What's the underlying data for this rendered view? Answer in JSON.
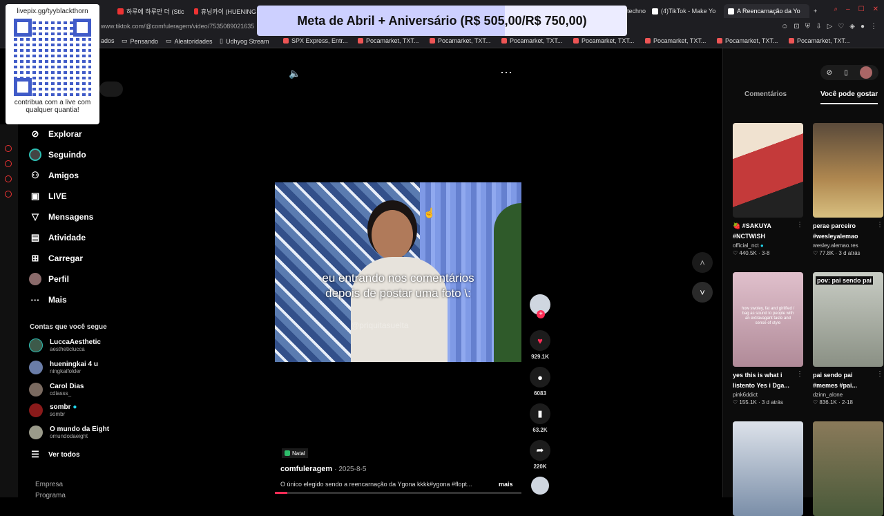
{
  "tabs": [
    {
      "label": "하루에 하루만 더 (Stic",
      "active": false
    },
    {
      "label": "휴닝카이 (HUENING",
      "active": false
    },
    {
      "label": "techno",
      "active": false
    },
    {
      "label": "(4)TikTok - Make Yo",
      "active": false
    },
    {
      "label": "A Reencarnação da Yo",
      "active": true
    }
  ],
  "url": "www.tiktok.com/@comfuleragem/video/7535089021635",
  "bookmarks": [
    "ados",
    "Pensando",
    "Aleatoridades",
    "Udhyog Stream",
    "SPX Express, Entr...",
    "Pocamarket, TXT...",
    "Pocamarket, TXT...",
    "Pocamarket, TXT...",
    "Pocamarket, TXT...",
    "Pocamarket, TXT...",
    "Pocamarket, TXT...",
    "Pocamarket, TXT..."
  ],
  "overlay": {
    "qr_title": "livepix.gg/tyyblackthorn",
    "qr_caption": "contribua com a live com qualquer quantia!",
    "goal": "Meta de Abril + Aniversário (R$ 505,00/R$ 750,00)",
    "goal_progress": 0.673
  },
  "nav": [
    {
      "label": "Explorar",
      "icon": "compass-icon"
    },
    {
      "label": "Seguindo",
      "icon": "following-icon"
    },
    {
      "label": "Amigos",
      "icon": "friends-icon"
    },
    {
      "label": "LIVE",
      "icon": "live-icon"
    },
    {
      "label": "Mensagens",
      "icon": "messages-icon"
    },
    {
      "label": "Atividade",
      "icon": "activity-icon"
    },
    {
      "label": "Carregar",
      "icon": "upload-icon"
    },
    {
      "label": "Perfil",
      "icon": "profile-icon"
    },
    {
      "label": "Mais",
      "icon": "more-icon"
    }
  ],
  "following_title": "Contas que você segue",
  "following": [
    {
      "name": "LuccaAesthetic",
      "handle": "aestheticlucca",
      "color": "#3d5a4a"
    },
    {
      "name": "hueningkai 4 u",
      "handle": "ningkaifolder",
      "color": "#6a7da8"
    },
    {
      "name": "Carol Dias",
      "handle": "cdiasss_",
      "color": "#7a6a60"
    },
    {
      "name": "sombr",
      "handle": "sombr",
      "color": "#8a1a1a",
      "verified": true
    },
    {
      "name": "O mundo da Eight",
      "handle": "omundodaeight",
      "color": "#9a9a8a"
    }
  ],
  "see_all": "Ver todos",
  "footer": [
    "Empresa",
    "Programa"
  ],
  "video": {
    "caption_line1": "eu entrando nos comentários",
    "caption_line2": "depois de postar uma foto \\:",
    "watermark": "@priquitasuelta",
    "tag": "Natal",
    "author": "comfuleragem",
    "date": "· 2025-8-5",
    "description": "O único elegido sendo a reencarnação da Ygona kkkk#ygona #flopt...",
    "more": "mais",
    "progress": 0.05
  },
  "actions": {
    "likes": "929.1K",
    "comments": "6083",
    "saves": "63.2K",
    "shares": "220K"
  },
  "right_tabs": [
    "Comentários",
    "Você pode gostar"
  ],
  "cards": [
    {
      "title": "🍓 #SAKUYA #NCTWISH",
      "author": "official_nct",
      "verified": true,
      "likes": "440.5K",
      "date": "3-8",
      "bg": "#c43a3a"
    },
    {
      "title": "perae parceiro #wesleyalemao",
      "author": "wesley.alemao.res",
      "likes": "77.8K",
      "date": "3 d atrás",
      "bg": "#7a5a3a"
    },
    {
      "title": "yes this is what i listento Yes i Dga...",
      "author": "pink6ddict",
      "likes": "155.1K",
      "date": "3 d atrás",
      "bg": "#c59aa8",
      "overlay": "how swoley, fat and girlified / bag as sound to people with an extravagant taste and sense of style"
    },
    {
      "title": "pai sendo pai #memes #pai...",
      "author": "dzinn_alone",
      "likes": "836.1K",
      "date": "2-18",
      "bg": "#9aa096",
      "overlay": "pov: pai sendo pai"
    },
    {
      "title": "",
      "author": "",
      "likes": "",
      "date": "",
      "bg": "#8a95a5"
    },
    {
      "title": "",
      "author": "",
      "likes": "",
      "date": "",
      "bg": "#6a6a4a"
    }
  ]
}
